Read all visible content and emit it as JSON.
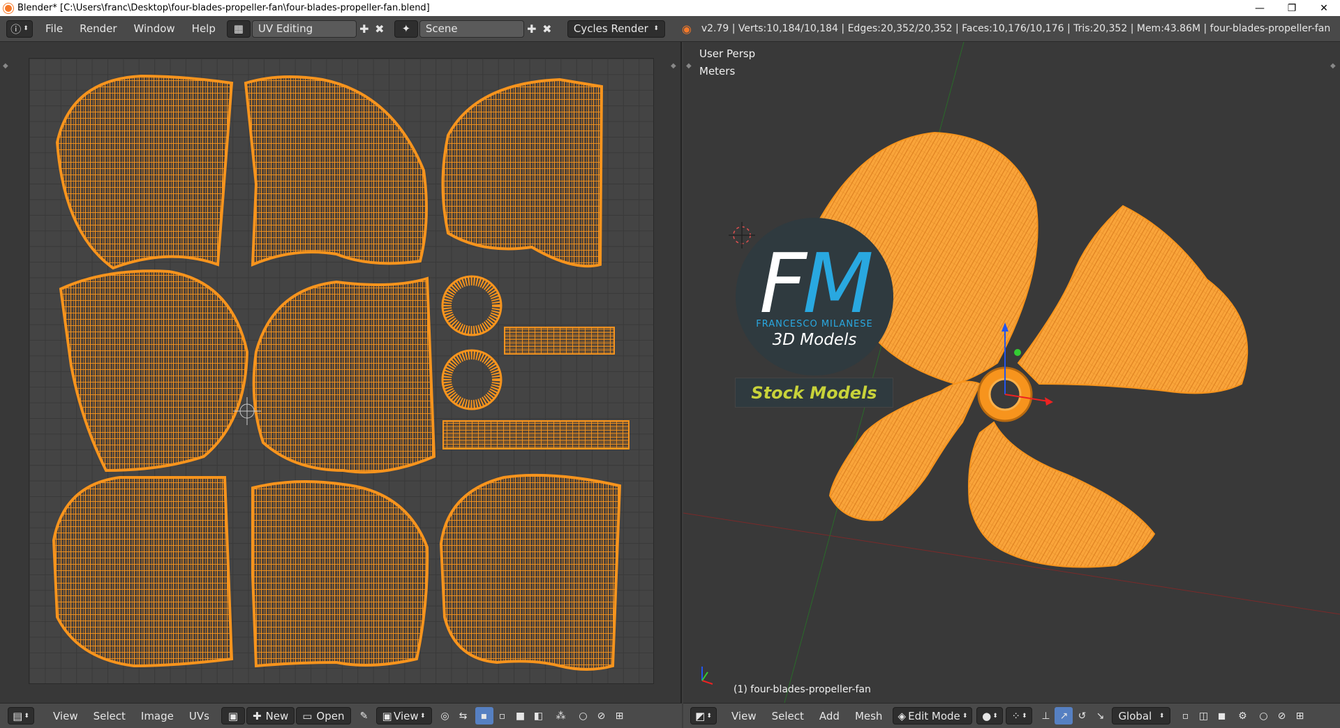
{
  "window": {
    "title": "Blender* [C:\\Users\\franc\\Desktop\\four-blades-propeller-fan\\four-blades-propeller-fan.blend]",
    "controls": [
      "—",
      "❐",
      "✕"
    ]
  },
  "topbar": {
    "menus": [
      "File",
      "Render",
      "Window",
      "Help"
    ],
    "screen_layout": "UV Editing",
    "scene": "Scene",
    "render_engine": "Cycles Render",
    "stats": "v2.79 | Verts:10,184/10,184 | Edges:20,352/20,352 | Faces:10,176/10,176 | Tris:20,352 | Mem:43.86M | four-blades-propeller-fan"
  },
  "viewport": {
    "view_name": "User Persp",
    "units": "Meters",
    "object_label": "(1) four-blades-propeller-fan"
  },
  "logo": {
    "letter_f": "F",
    "letter_m": "M",
    "subtitle": "FRANCESCO MILANESE",
    "tagline": "3D Models",
    "banner": "Stock Models"
  },
  "uv_bottombar": {
    "menus": [
      "View",
      "Select",
      "Image",
      "UVs"
    ],
    "new_label": "New",
    "open_label": "Open",
    "view_label": "View"
  },
  "vp_bottombar": {
    "menus": [
      "View",
      "Select",
      "Add",
      "Mesh"
    ],
    "mode": "Edit Mode",
    "orientation": "Global"
  },
  "colors": {
    "mesh_orange": "#f7941d",
    "accent_blue": "#5680c2"
  }
}
